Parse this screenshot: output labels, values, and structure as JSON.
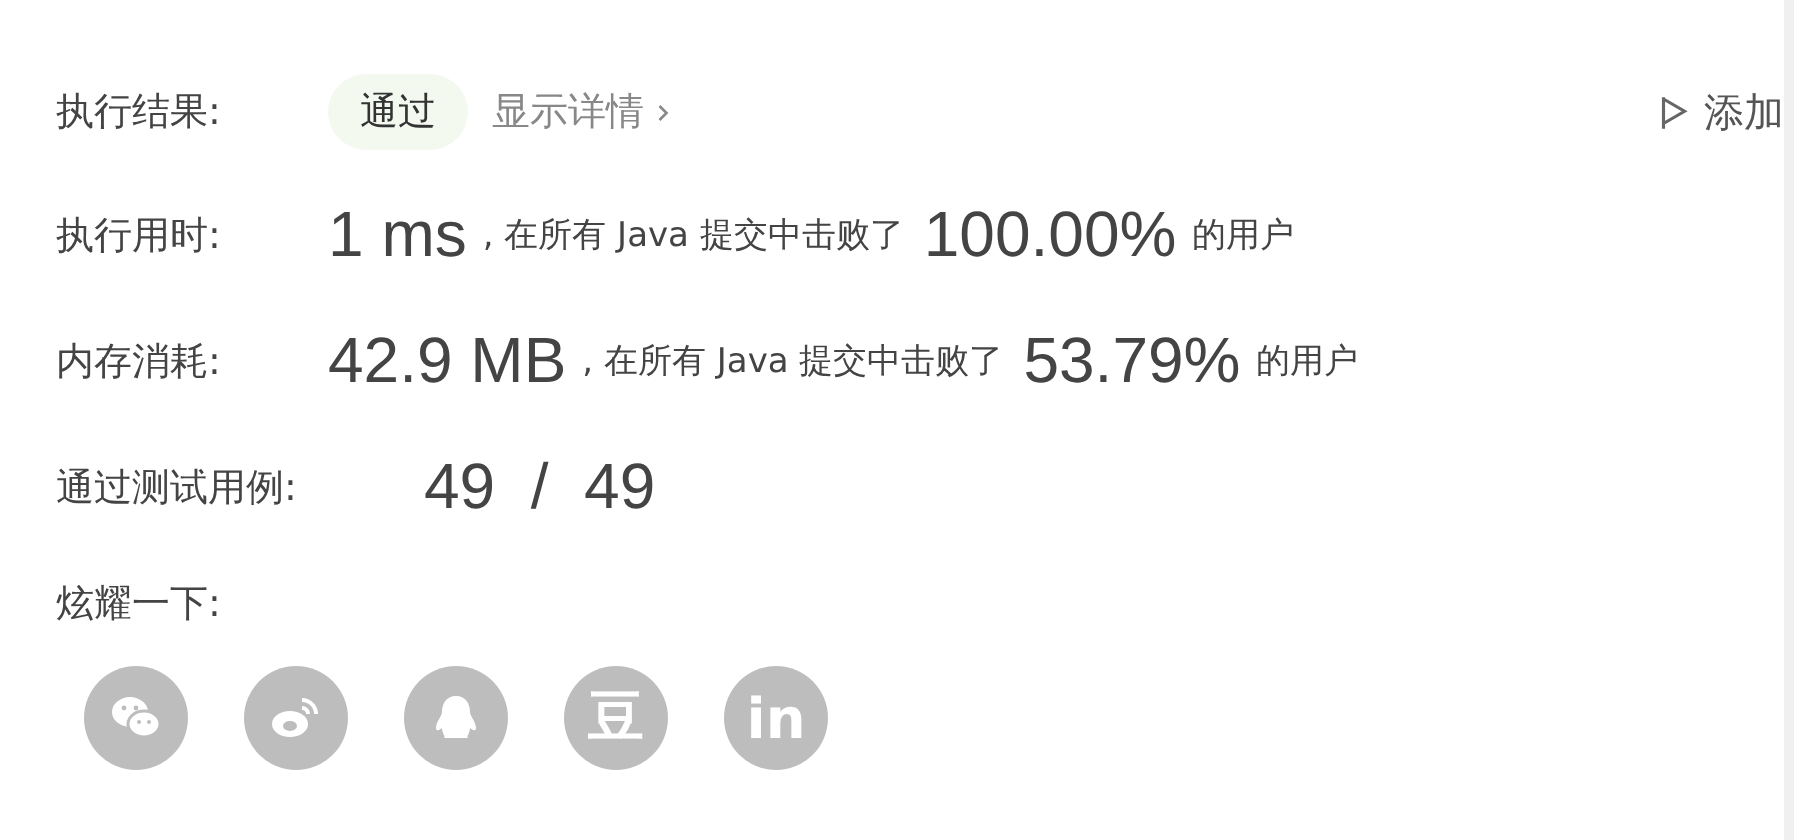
{
  "result": {
    "label": "执行结果:",
    "status": "通过",
    "details_link": "显示详情",
    "add_button": "添加"
  },
  "stats": [
    {
      "label": "执行用时:",
      "value": "1 ms",
      "text": ", 在所有 Java 提交中击败了",
      "percent": "100.00%",
      "suffix": "的用户"
    },
    {
      "label": "内存消耗:",
      "value": "42.9 MB",
      "text": ", 在所有 Java 提交中击败了",
      "percent": "53.79%",
      "suffix": "的用户"
    }
  ],
  "tests": {
    "label": "通过测试用例:",
    "value": "49  /  49"
  },
  "share": {
    "label": "炫耀一下:",
    "buttons": [
      {
        "kind": "wechat"
      },
      {
        "kind": "weibo"
      },
      {
        "kind": "qq"
      },
      {
        "kind": "glyph",
        "text": "豆"
      },
      {
        "kind": "glyph",
        "text": "in"
      }
    ]
  }
}
